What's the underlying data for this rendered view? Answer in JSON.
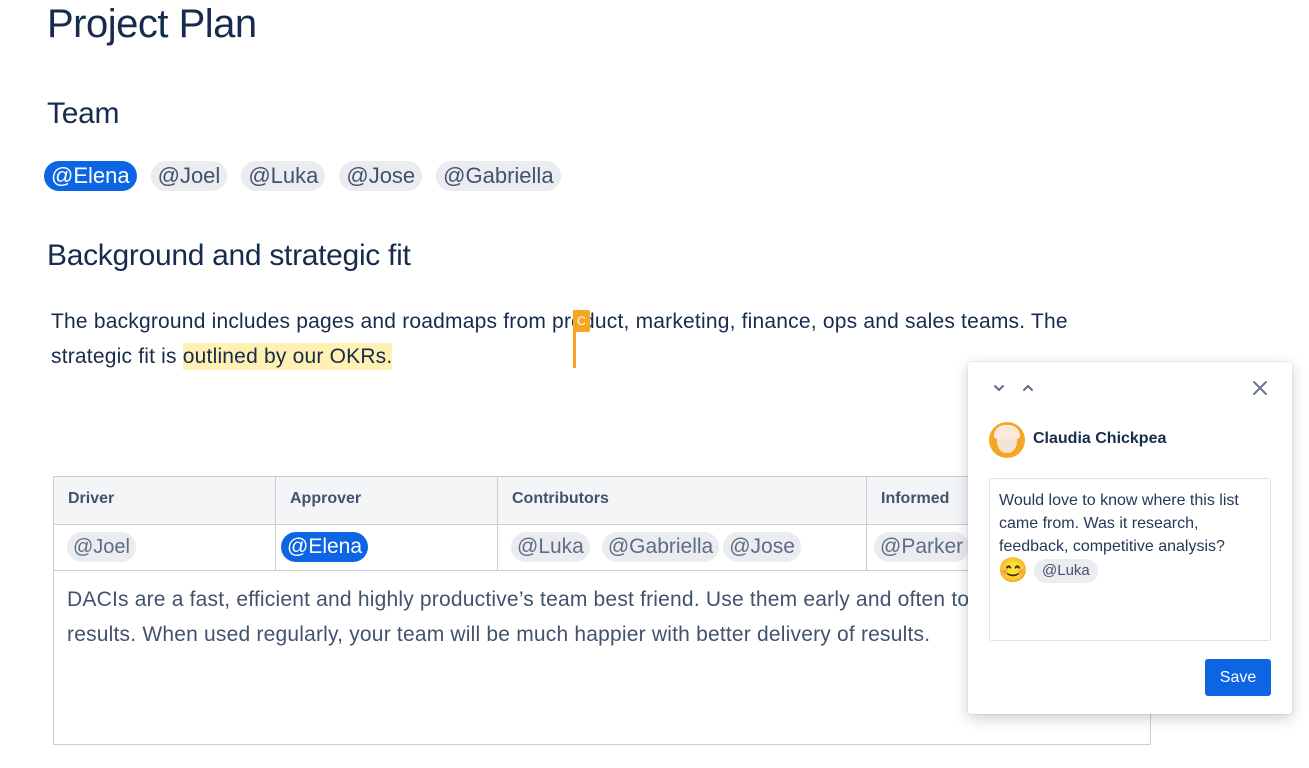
{
  "page": {
    "title": "Project Plan",
    "team_heading": "Team",
    "team_mentions": [
      "@Elena",
      "@Joel",
      "@Luka",
      "@Jose",
      "@Gabriella"
    ],
    "background_heading": "Background and strategic fit",
    "background_text_before": "The background includes pages and roadmaps from product, marketing, finance, ops and sales teams. The strategic fit is ",
    "background_text_highlight": "outlined by our OKRs."
  },
  "cursor": {
    "label": "C",
    "color": "#f5a623"
  },
  "table": {
    "headers": [
      "Driver",
      "Approver",
      "Contributors",
      "Informed"
    ],
    "driver": [
      "@Joel"
    ],
    "approver": [
      "@Elena"
    ],
    "contributors": [
      "@Luka",
      "@Gabriella",
      "@Jose"
    ],
    "informed": [
      "@Parker"
    ],
    "body_text": "DACIs are a fast, efficient and highly productive’s team best friend. Use them early and often to get the best results. When used regularly, your team will be much happier with better delivery of results."
  },
  "comment": {
    "author": "Claudia Chickpea",
    "text": "Would love to know where this list came from. Was it research, feedback, competitive analysis?",
    "emoji": "😊",
    "mention": "@Luka",
    "save_label": "Save",
    "nav_down_icon": "chevron-down-icon",
    "nav_up_icon": "chevron-up-icon",
    "close_icon": "close-icon"
  },
  "colors": {
    "accent": "#0c66e4",
    "highlight": "#fff0b3",
    "cursor": "#f5a623"
  }
}
